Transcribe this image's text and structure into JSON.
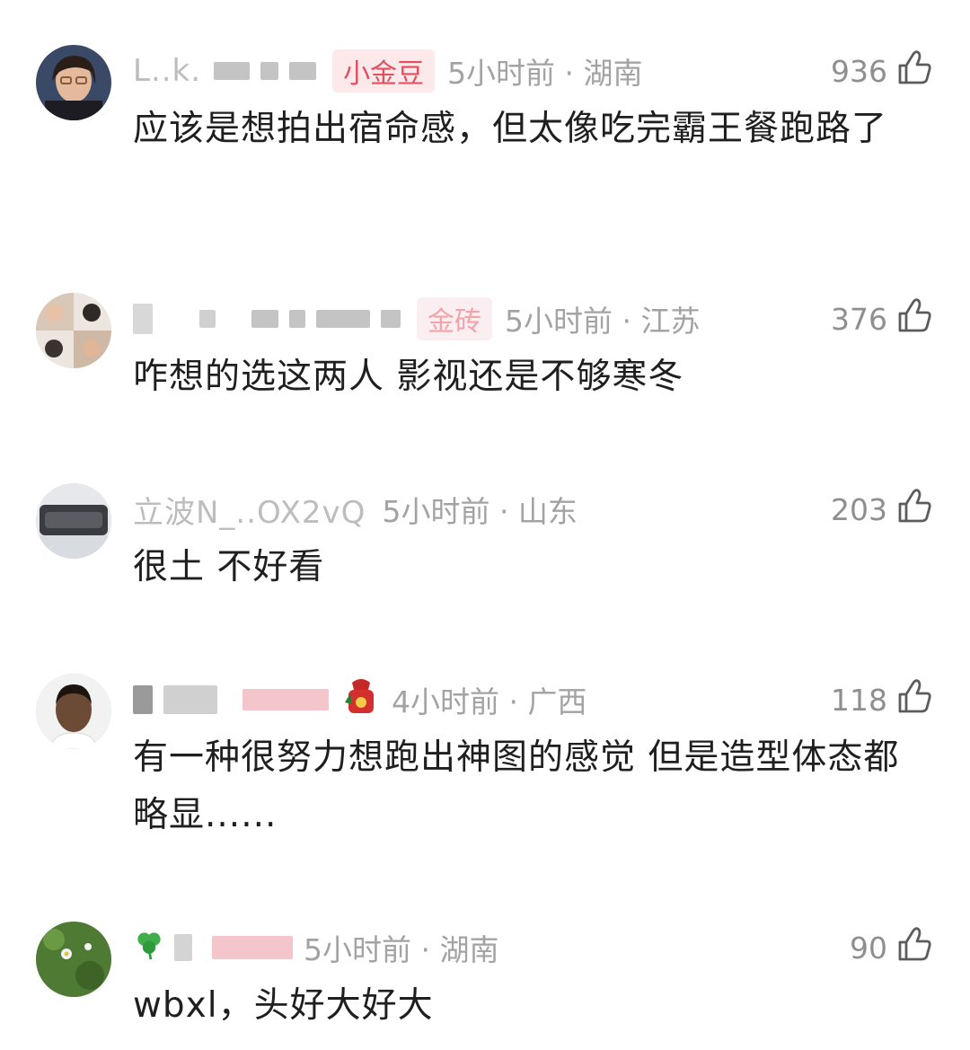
{
  "comments": [
    {
      "username": "L..k.",
      "badge": "小金豆",
      "time": "5小时前 · 湖南",
      "likes": "936",
      "text": "应该是想拍出宿命感，但太像吃完霸王餐跑路了"
    },
    {
      "username": "",
      "badge": "金砖",
      "time": "5小时前 · 江苏",
      "likes": "376",
      "text": "咋想的选这两人   影视还是不够寒冬"
    },
    {
      "username": "立波N_..OX2vQ",
      "badge": "",
      "time": "5小时前 · 山东",
      "likes": "203",
      "text": "很土 不好看"
    },
    {
      "username": "",
      "badge": "",
      "time": "4小时前 · 广西",
      "likes": "118",
      "text": "有一种很努力想跑出神图的感觉 但是造型体态都略显......"
    },
    {
      "username": "",
      "badge": "",
      "time": "5小时前 · 湖南",
      "likes": "90",
      "text": "wbxl，头好大好大"
    }
  ],
  "icons": {
    "like": "thumbs-up-icon"
  },
  "colors": {
    "badge_text": "#e0505f",
    "badge_bg": "#fde8ea",
    "meta_text": "#9a9a9a"
  }
}
